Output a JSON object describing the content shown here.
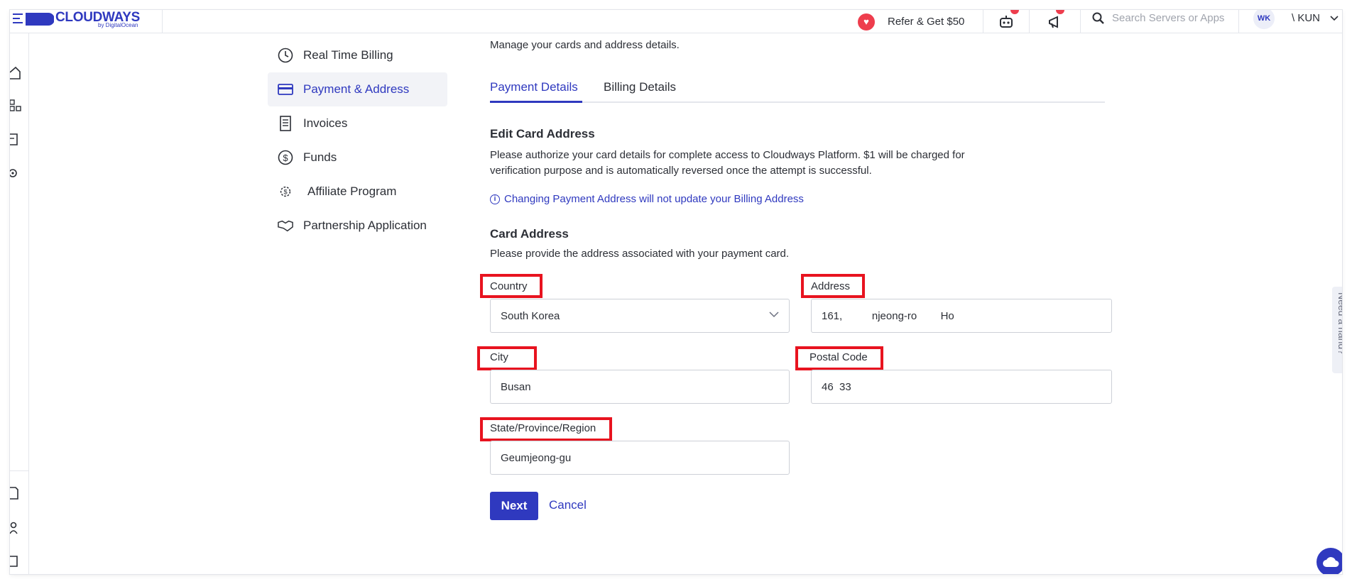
{
  "app": {
    "logo_text": "CLOUDWAYS",
    "logo_sub": "by DigitalOcean"
  },
  "topbar": {
    "refer_label": "Refer & Get $50",
    "search_placeholder": "Search Servers or Apps",
    "avatar_initials": "WK",
    "user_name": "\\ KUN"
  },
  "subnav": {
    "items": [
      {
        "label": "Real Time Billing",
        "icon": "clock-icon"
      },
      {
        "label": "Payment & Address",
        "icon": "credit-card-icon",
        "active": true
      },
      {
        "label": "Invoices",
        "icon": "invoice-icon"
      },
      {
        "label": "Funds",
        "icon": "dollar-icon"
      },
      {
        "label": "Affiliate Program",
        "icon": "affiliate-icon"
      },
      {
        "label": "Partnership Application",
        "icon": "handshake-icon"
      }
    ]
  },
  "main": {
    "intro": "Manage your cards and address details.",
    "tabs": [
      {
        "label": "Payment Details",
        "active": true
      },
      {
        "label": "Billing Details",
        "active": false
      }
    ],
    "edit_heading": "Edit Card Address",
    "edit_desc": "Please authorize your card details for complete access to Cloudways Platform. $1 will be charged for verification purpose and is automatically reversed once the attempt is successful.",
    "notice": "Changing Payment Address will not update your Billing Address",
    "card_heading": "Card Address",
    "card_desc": "Please provide the address associated with your payment card."
  },
  "form": {
    "country_label": "Country",
    "country_value": "South Korea",
    "address_label": "Address",
    "address_value": "161,          njeong-ro        Ho",
    "city_label": "City",
    "city_value": "Busan",
    "postal_label": "Postal Code",
    "postal_value": "46  33",
    "state_label": "State/Province/Region",
    "state_value": "Geumjeong-gu",
    "next_label": "Next",
    "cancel_label": "Cancel"
  },
  "widgets": {
    "need_hand": "Need a hand?"
  },
  "colors": {
    "brand": "#2f39bf",
    "highlight_box": "#e8131f",
    "notification": "#ee3d4d"
  }
}
